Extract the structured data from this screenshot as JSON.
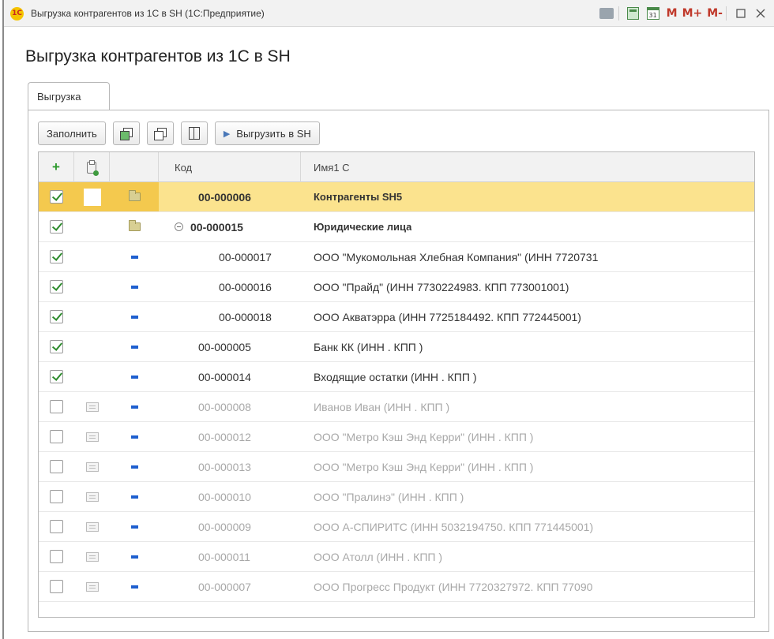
{
  "window": {
    "title": "Выгрузка контрагентов из 1С в SH  (1С:Предприятие)",
    "logo": "1С",
    "calendar_day": "31",
    "mem_buttons": [
      "M",
      "M+",
      "M-"
    ],
    "controls": [
      "restore-icon",
      "close-icon"
    ]
  },
  "page": {
    "title": "Выгрузка контрагентов из 1С в SH"
  },
  "tabs": [
    {
      "label": "Выгрузка"
    }
  ],
  "toolbar": {
    "fill_label": "Заполнить",
    "check_all_icon": "check-all-icon",
    "uncheck_all_icon": "uncheck-all-icon",
    "columns_icon": "columns-icon",
    "export_label": "Выгрузить в SH"
  },
  "grid": {
    "columns": [
      "+",
      "",
      "",
      "Код",
      "Имя1 С"
    ],
    "rows": [
      {
        "checked": true,
        "icon": "folder",
        "code": "00-000006",
        "name": "Контрагенты SH5",
        "bold": true,
        "selected": true,
        "indent": 1,
        "faded": false
      },
      {
        "checked": true,
        "icon": "folder",
        "code": "00-000015",
        "name": "Юридические лица",
        "bold": true,
        "selected": false,
        "indent": 1,
        "expander": true,
        "faded": false
      },
      {
        "checked": true,
        "icon": "item",
        "code": "00-000017",
        "name": "ООО \"Мукомольная Хлебная Компания\" (ИНН 7720731",
        "bold": false,
        "indent": 2,
        "faded": false
      },
      {
        "checked": true,
        "icon": "item",
        "code": "00-000016",
        "name": "ООО \"Прайд\" (ИНН 7730224983. КПП 773001001)",
        "bold": false,
        "indent": 2,
        "faded": false
      },
      {
        "checked": true,
        "icon": "item",
        "code": "00-000018",
        "name": "ООО Акватэрра (ИНН 7725184492. КПП 772445001)",
        "bold": false,
        "indent": 2,
        "faded": false
      },
      {
        "checked": true,
        "icon": "item",
        "code": "00-000005",
        "name": "Банк КК (ИНН . КПП )",
        "bold": false,
        "indent": 0,
        "faded": false
      },
      {
        "checked": true,
        "icon": "item",
        "code": "00-000014",
        "name": "Входящие остатки (ИНН . КПП )",
        "bold": false,
        "indent": 0,
        "faded": false
      },
      {
        "checked": false,
        "doc": true,
        "icon": "item",
        "code": "00-000008",
        "name": "Иванов Иван (ИНН . КПП )",
        "indent": 0,
        "faded": true
      },
      {
        "checked": false,
        "doc": true,
        "icon": "item",
        "code": "00-000012",
        "name": "ООО \"Метро Кэш Энд Керри\" (ИНН . КПП )",
        "indent": 0,
        "faded": true
      },
      {
        "checked": false,
        "doc": true,
        "icon": "item",
        "code": "00-000013",
        "name": "ООО \"Метро Кэш Энд Керри\" (ИНН . КПП )",
        "indent": 0,
        "faded": true
      },
      {
        "checked": false,
        "doc": true,
        "icon": "item",
        "code": "00-000010",
        "name": "ООО \"Пралинэ\" (ИНН . КПП )",
        "indent": 0,
        "faded": true
      },
      {
        "checked": false,
        "doc": true,
        "icon": "item",
        "code": "00-000009",
        "name": "ООО А-СПИРИТС (ИНН 5032194750. КПП 771445001)",
        "indent": 0,
        "faded": true
      },
      {
        "checked": false,
        "doc": true,
        "icon": "item",
        "code": "00-000011",
        "name": "ООО Атолл (ИНН . КПП )",
        "indent": 0,
        "faded": true
      },
      {
        "checked": false,
        "doc": true,
        "icon": "item",
        "code": "00-000007",
        "name": "ООО Прогресс Продукт (ИНН 7720327972. КПП 77090",
        "indent": 0,
        "faded": true
      }
    ]
  }
}
